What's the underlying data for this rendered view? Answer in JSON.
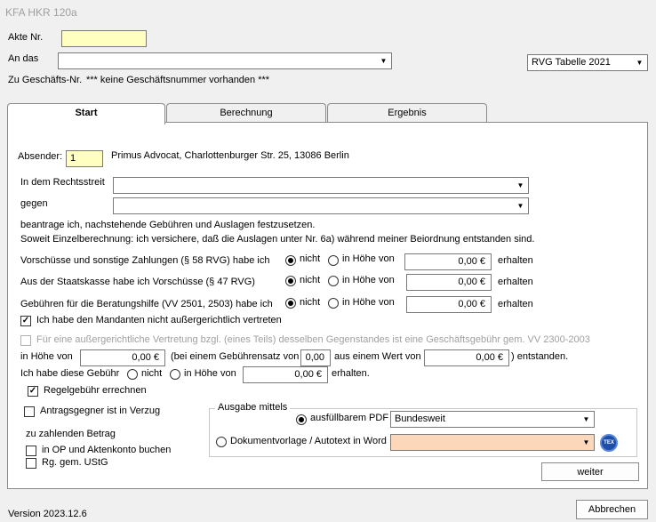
{
  "window": {
    "title": "KFA HKR 120a"
  },
  "header": {
    "akte_label": "Akte Nr.",
    "akte_value": "",
    "an_das_label": "An das",
    "an_das_value": "",
    "rvg_value": "RVG Tabelle 2021",
    "geschaeft_label": "Zu Geschäfts-Nr.",
    "geschaeft_value": "*** keine Geschäftsnummer vorhanden ***"
  },
  "tabs": [
    {
      "label": "Start",
      "active": true
    },
    {
      "label": "Berechnung",
      "active": false
    },
    {
      "label": "Ergebnis",
      "active": false
    }
  ],
  "start": {
    "absender_label": "Absender:",
    "absender_value": "1",
    "absender_text": "Primus Advocat, Charlottenburger Str. 25, 13086 Berlin",
    "rechtsstreit_label": "In dem Rechtsstreit",
    "rechtsstreit_value": "",
    "gegen_label": "gegen",
    "gegen_value": "",
    "line1": "beantrage ich, nachstehende Gebühren und Auslagen festzusetzen.",
    "line2": "Soweit Einzelberechnung: ich versichere, daß die Auslagen unter Nr. 6a) während meiner Beiordnung entstanden sind.",
    "rows": [
      {
        "label": "Vorschüsse und sonstige Zahlungen (§ 58 RVG) habe ich",
        "opt_nicht": "nicht",
        "opt_hoehe": "in Höhe von",
        "value": "0,00 €",
        "suffix": "erhalten"
      },
      {
        "label": "Aus der Staatskasse habe ich Vorschüsse (§ 47 RVG)",
        "opt_nicht": "nicht",
        "opt_hoehe": "in Höhe von",
        "value": "0,00 €",
        "suffix": "erhalten"
      },
      {
        "label": "Gebühren für die Beratungshilfe (VV 2501, 2503) habe ich",
        "opt_nicht": "nicht",
        "opt_hoehe": "in Höhe von",
        "value": "0,00 €",
        "suffix": "erhalten"
      }
    ],
    "mandant_check": "Ich habe den Mandanten nicht außergerichtlich vertreten",
    "vertretung_check": "Für eine außergerichtliche Vertretung bzgl. (eines Teils) desselben Gegenstandes ist eine Geschäftsgebühr gem. VV 2300-2003",
    "hoehe_label": "in Höhe von",
    "hoehe_value": "0,00 €",
    "gebuehrensatz_label": "(bei einem Gebührensatz von",
    "gebuehrensatz_value": "0,00",
    "wert_label": "aus einem Wert von",
    "wert_value": "0,00 €",
    "entstanden": ") entstanden.",
    "diese_label": "Ich habe diese Gebühr",
    "diese_nicht": "nicht",
    "diese_hoehe": "in Höhe von",
    "diese_value": "0,00 €",
    "diese_suffix": "erhalten.",
    "regel_check": "Regelgebühr errechnen",
    "verzug_check": "Antragsgegner ist in Verzug",
    "zahlen_label": "zu zahlenden Betrag",
    "op_check": "in OP und Aktenkonto buchen",
    "ustg_check": "Rg. gem. UStG",
    "ausgabe": {
      "legend": "Ausgabe mittels",
      "pdf_label": "ausfüllbarem PDF",
      "pdf_value": "Bundesweit",
      "word_label": "Dokumentvorlage / Autotext in Word",
      "word_value": "",
      "word_icon_text": "TEX"
    },
    "weiter": "weiter"
  },
  "footer": {
    "version": "Version 2023.12.6",
    "abbrechen": "Abbrechen"
  }
}
